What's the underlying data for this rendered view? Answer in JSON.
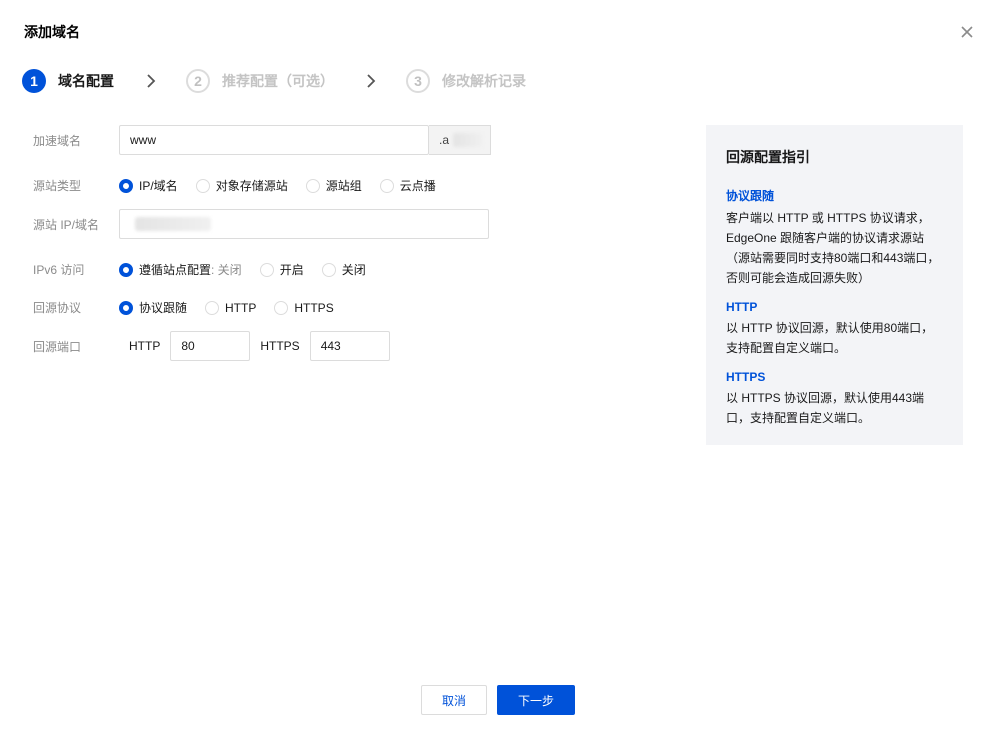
{
  "dialog": {
    "title": "添加域名"
  },
  "steps": [
    {
      "num": "1",
      "label": "域名配置",
      "state": "active"
    },
    {
      "num": "2",
      "label": "推荐配置（可选）",
      "state": "inactive"
    },
    {
      "num": "3",
      "label": "修改解析记录",
      "state": "inactive"
    }
  ],
  "form": {
    "domain": {
      "label": "加速域名",
      "value": "www",
      "suffix": ".a"
    },
    "origin_type": {
      "label": "源站类型",
      "options": [
        "IP/域名",
        "对象存储源站",
        "源站组",
        "云点播"
      ],
      "selected": "IP/域名"
    },
    "origin_ip": {
      "label": "源站 IP/域名",
      "value": ""
    },
    "ipv6": {
      "label": "IPv6 访问",
      "option1_main": "遵循站点配置",
      "option1_muted": ": 关闭",
      "option2": "开启",
      "option3": "关闭",
      "selected": "遵循站点配置"
    },
    "protocol": {
      "label": "回源协议",
      "options": [
        "协议跟随",
        "HTTP",
        "HTTPS"
      ],
      "selected": "协议跟随"
    },
    "port": {
      "label": "回源端口",
      "http_label": "HTTP",
      "http_value": "80",
      "https_label": "HTTPS",
      "https_value": "443"
    }
  },
  "guide": {
    "title": "回源配置指引",
    "sections": [
      {
        "title": "协议跟随",
        "body": "客户端以 HTTP 或 HTTPS 协议请求，EdgeOne 跟随客户端的协议请求源站（源站需要同时支持80端口和443端口，否则可能会造成回源失败）"
      },
      {
        "title": "HTTP",
        "body": "以 HTTP 协议回源，默认使用80端口，支持配置自定义端口。"
      },
      {
        "title": "HTTPS",
        "body": "以 HTTPS 协议回源，默认使用443端口，支持配置自定义端口。"
      }
    ]
  },
  "footer": {
    "cancel_label": "取消",
    "next_label": "下一步"
  },
  "colors": {
    "brand": "#0052d9",
    "guide_bg": "#f3f4f7",
    "muted_text": "#8b8b8b"
  }
}
